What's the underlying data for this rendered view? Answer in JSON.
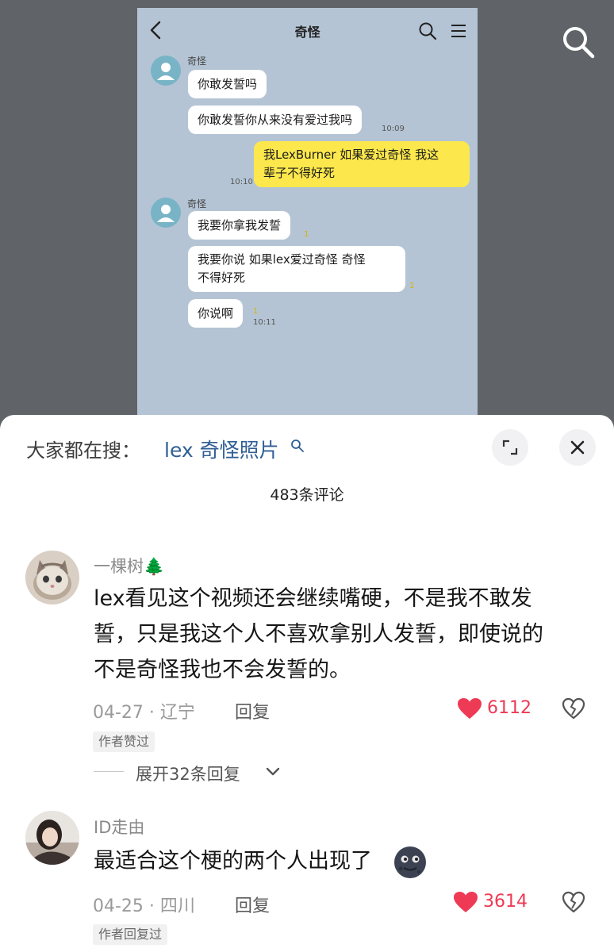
{
  "chat": {
    "title": "奇怪",
    "sender": "奇怪",
    "messages": [
      {
        "text": "你敢发誓吗"
      },
      {
        "text": "你敢发誓你从来没有爱过我吗",
        "time": "10:09"
      },
      {
        "text_line1": "我LexBurner  如果爱过奇怪    我这",
        "text_line2": "辈子不得好死",
        "time": "10:10"
      },
      {
        "text": "我要你拿我发誓",
        "read": "1"
      },
      {
        "text_line1": "我要你说    如果lex爱过奇怪    奇怪",
        "text_line2": "不得好死",
        "read": "1"
      },
      {
        "text": "你说啊",
        "read": "1",
        "time": "10:11"
      }
    ]
  },
  "panel": {
    "hot_prefix": "大家都在搜：",
    "hot_query": "lex 奇怪照片",
    "comment_count": "483条评论"
  },
  "comments": [
    {
      "name": "一棵树🌲",
      "text_lines": [
        "lex看见这个视频还会继续嘴硬，不是我不敢发",
        "誓，只是我这个人不喜欢拿别人发誓，即使说的",
        "不是奇怪我也不会发誓的。"
      ],
      "meta": "04-27 · 辽宁",
      "reply": "回复",
      "likes": "6112",
      "tag": "作者赞过",
      "expand": "展开32条回复"
    },
    {
      "name": "ID走由",
      "text": "最适合这个梗的两个人出现了",
      "meta": "04-25 · 四川",
      "reply": "回复",
      "likes": "3614",
      "tag": "作者回复过"
    }
  ],
  "icons": {
    "video_search": "search-icon",
    "chat_back": "back-arrow-icon",
    "chat_search": "search-icon",
    "chat_menu": "menu-icon",
    "expand": "expand-icon",
    "close": "close-icon",
    "like": "heart-icon",
    "dislike": "broken-heart-icon",
    "emoji": "moon-face-emoji"
  },
  "colors": {
    "chat_bg": "#b4c4d4",
    "self_bubble": "#fce84c",
    "link": "#2f5e94",
    "like": "#ee3a55"
  }
}
